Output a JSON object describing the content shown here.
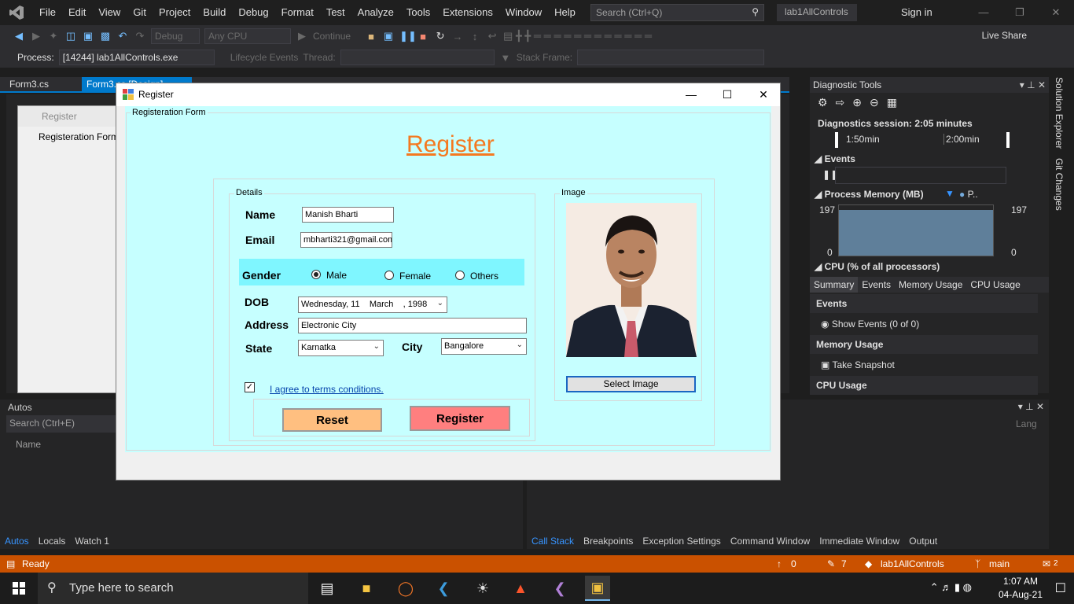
{
  "menubar": {
    "items": [
      "File",
      "Edit",
      "View",
      "Git",
      "Project",
      "Build",
      "Debug",
      "Format",
      "Test",
      "Analyze",
      "Tools",
      "Extensions",
      "Window",
      "Help"
    ],
    "search_placeholder": "Search (Ctrl+Q)",
    "solution_name": "lab1AllControls",
    "signin": "Sign in"
  },
  "toolbar": {
    "config": "Debug",
    "platform": "Any CPU",
    "continue": "Continue",
    "liveshare": "Live Share",
    "process_label": "Process:",
    "process_value": "[14244] lab1AllControls.exe",
    "lifecycle_label": "Lifecycle Events",
    "thread_label": "Thread:",
    "stackframe_label": "Stack Frame:"
  },
  "doc_tabs": [
    "Form3.cs",
    "Form3.cs [Design]"
  ],
  "designer": {
    "form_title": "Register",
    "group_label": "Registeration Form"
  },
  "autos": {
    "title": "Autos",
    "search": "Search (Ctrl+E)",
    "col_name": "Name",
    "col_lang": "Lang"
  },
  "bottom_tabs_left": [
    "Autos",
    "Locals",
    "Watch 1"
  ],
  "bottom_tabs_right": [
    "Call Stack",
    "Breakpoints",
    "Exception Settings",
    "Command Window",
    "Immediate Window",
    "Output"
  ],
  "diag": {
    "title": "Diagnostic Tools",
    "session": "Diagnostics session: 2:05 minutes",
    "t1": "1:50min",
    "t2": "2:00min",
    "events": "Events",
    "process_memory": "Process Memory (MB)",
    "mem_legend": "P..",
    "mem_max": "197",
    "mem_min": "0",
    "cpu": "CPU (% of all processors)",
    "tabs": [
      "Summary",
      "Events",
      "Memory Usage",
      "CPU Usage"
    ],
    "sec_events": "Events",
    "show_events": "Show Events (0 of 0)",
    "sec_memory": "Memory Usage",
    "take_snapshot": "Take Snapshot",
    "sec_cpu": "CPU Usage"
  },
  "side_tabs": [
    "Solution Explorer",
    "Git Changes"
  ],
  "statusbar": {
    "ready": "Ready",
    "up_count": "0",
    "pencil_count": "7",
    "project": "lab1AllControls",
    "branch": "main",
    "notif_count": "2"
  },
  "taskbar": {
    "search": "Type here to search",
    "time": "1:07 AM",
    "date": "04-Aug-21"
  },
  "register_form": {
    "window_title": "Register",
    "group_title": "Registeration Form",
    "heading": "Register",
    "details_label": "Details",
    "image_label": "Image",
    "name_label": "Name",
    "name_value": "Manish Bharti",
    "email_label": "Email",
    "email_value": "mbharti321@gmail.com",
    "gender_label": "Gender",
    "gender_options": [
      "Male",
      "Female",
      "Others"
    ],
    "gender_selected": "Male",
    "dob_label": "DOB",
    "dob_value": "Wednesday, 11    March    , 1998",
    "address_label": "Address",
    "address_value": "Electronic City",
    "state_label": "State",
    "state_value": "Karnatka",
    "city_label": "City",
    "city_value": "Bangalore",
    "terms_text": "I agree to terms  conditions.",
    "terms_checked": true,
    "reset_label": "Reset",
    "register_label": "Register",
    "select_image_label": "Select Image"
  }
}
